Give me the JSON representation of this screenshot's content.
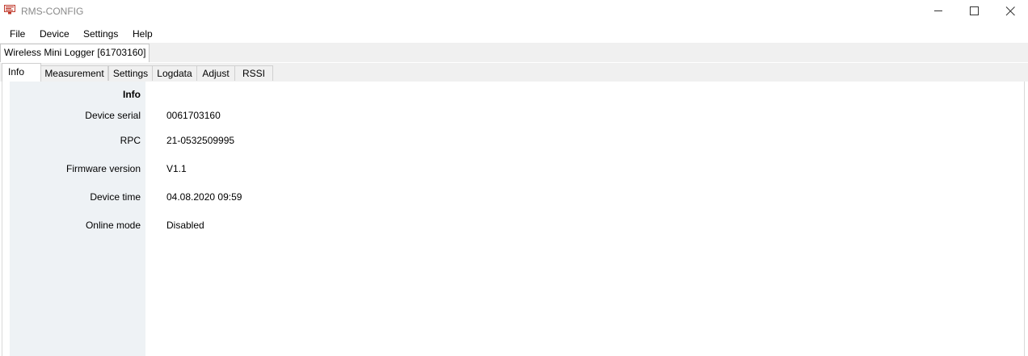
{
  "window": {
    "title": "RMS-CONFIG",
    "icon": "monitor-display-icon",
    "accent_color": "#c0392b"
  },
  "menu": {
    "items": [
      "File",
      "Device",
      "Settings",
      "Help"
    ]
  },
  "document_tab": {
    "label": "Wireless Mini Logger [61703160]"
  },
  "tabs": [
    "Info",
    "Measurement",
    "Settings",
    "Logdata",
    "Adjust",
    "RSSI"
  ],
  "active_tab": "Info",
  "info": {
    "section_title": "Info",
    "rows": [
      {
        "label": "Device serial",
        "value": "0061703160"
      },
      {
        "label": "RPC",
        "value": "21-0532509995"
      },
      {
        "label": "Firmware version",
        "value": "V1.1"
      },
      {
        "label": "Device time",
        "value": "04.08.2020 09:59"
      },
      {
        "label": "Online mode",
        "value": "Disabled"
      }
    ]
  }
}
